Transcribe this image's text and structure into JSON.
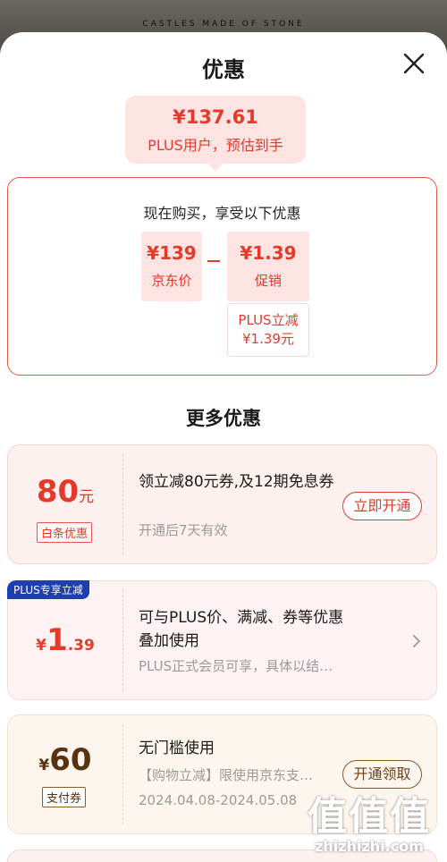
{
  "backdrop": {
    "strip_text": "CASTLES MADE OF STONE"
  },
  "header": {
    "title": "优惠"
  },
  "price_bubble": {
    "amount": "¥137.61",
    "caption": "PLUS用户，预估到手"
  },
  "calc": {
    "heading": "现在购买，享受以下优惠",
    "base": {
      "value": "¥139",
      "label": "京东价"
    },
    "promo": {
      "value": "¥1.39",
      "label": "促销"
    },
    "promo_detail": {
      "line1": "PLUS立减",
      "line2": "¥1.39元"
    }
  },
  "more_title": "更多优惠",
  "coupons": [
    {
      "amount": "80",
      "unit": "元",
      "tag": "白条优惠",
      "desc": "领立减80元券,及12期免息券",
      "meta": "开通后7天有效",
      "action": "立即开通"
    },
    {
      "badge": "PLUS专享立减",
      "currency": "¥",
      "amount": "1",
      "decimals": ".39",
      "desc": "可与PLUS价、满减、券等优惠叠加使用",
      "meta": "PLUS正式会员可享，具体以结…"
    },
    {
      "currency": "¥",
      "amount": "60",
      "tag": "支付券",
      "desc": "无门槛使用",
      "meta": "【购物立减】限使用京东支…",
      "date": "2024.04.08-2024.05.08",
      "action": "开通领取"
    }
  ],
  "watermark": {
    "logo": "值值值",
    "domain": "zhizhizhi.com"
  },
  "colors": {
    "accent": "#e43a2c",
    "pale": "#fde3e1",
    "plus_blue": "#1f3fae",
    "gold": "#8a5a2b"
  }
}
